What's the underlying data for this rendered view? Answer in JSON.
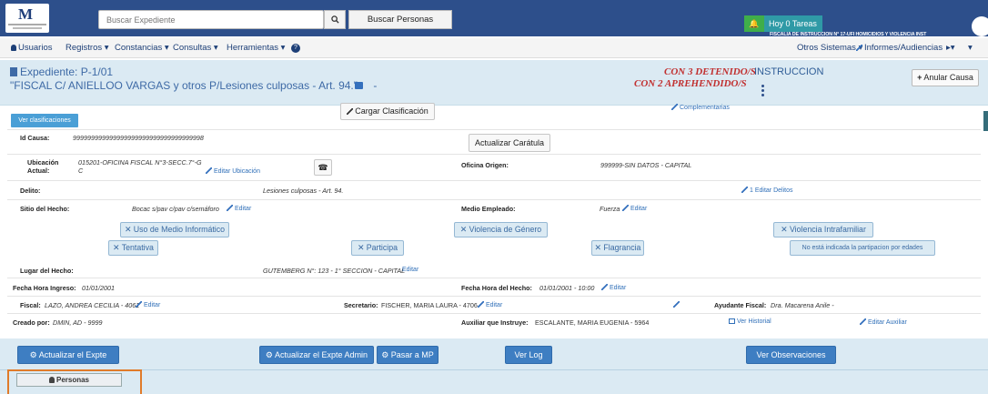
{
  "topbar": {
    "search_placeholder": "Buscar Expediente",
    "search_icon": "search-icon",
    "buscar_personas": "Buscar Personas",
    "tareas": "Hoy 0 Tareas",
    "fiscalia": "FISCALIA DE INSTRUCCION N° 17-UFI HOMICIDIOS Y VIOLENCIA INST",
    "colors": {
      "bar": "#2d4f8b",
      "bell": "#3fae4a",
      "tareas": "#2f9aa6"
    }
  },
  "menu": {
    "usuarios": "Usuarios",
    "registros": "Registros",
    "constancias": "Constancias",
    "consultas": "Consultas",
    "herramientas": "Herramientas",
    "otros_sistemas": "Otros Sistemas",
    "informes": "Informes/Audiencias"
  },
  "header": {
    "expediente": "Expediente: P-1/01",
    "caratula": "\"FISCAL C/ ANIELLOO VARGAS y otros P/Lesiones culposas - Art. 94.\"",
    "dash": "-",
    "detenidos": "CON 3 DETENIDO/S",
    "aprehendidos": "CON 2 APREHENDIDO/S",
    "estado": "INSTRUCCION",
    "anular": "Anular Causa",
    "anular_prefix": "+"
  },
  "actions": {
    "ver_clasificaciones": "Ver clasificaciones",
    "cargar_clasificacion": "Cargar Clasificación",
    "complementarias": "Complementarias"
  },
  "fields": {
    "id_causa_label": "Id Causa:",
    "id_causa": "999999999999999999999999999999999998",
    "actualizar_caratula": "Actualizar Carátula",
    "ubicacion_label": "Ubicación",
    "actual_label": "Actual:",
    "ubicacion_value": "015201-OFICINA FISCAL N°3-SECC.7°-G",
    "ubicacion_value2": "C",
    "editar_ubicacion": "Editar Ubicación",
    "oficina_origen_label": "Oficina Origen:",
    "oficina_origen": "999999-SIN DATOS - CAPITAL",
    "delito_label": "Delito:",
    "delito": "Lesiones culposas - Art. 94.",
    "editar_delitos": "1 Editar Delitos",
    "sitio_label": "Sitio del Hecho:",
    "sitio": "Bocac s/pav c/pav c/semáforo",
    "editar": "Editar",
    "medio_label": "Medio Empleado:",
    "medio": "Fuerza",
    "lugar_label": "Lugar del Hecho:",
    "lugar": "GUTEMBERG N°: 123 - 1° SECCION - CAPITAL",
    "fecha_ingreso_label": "Fecha Hora Ingreso:",
    "fecha_ingreso": "01/01/2001",
    "fecha_hecho_label": "Fecha Hora del Hecho:",
    "fecha_hecho": "01/01/2001 - 10:00",
    "fiscal_label": "Fiscal:",
    "fiscal": "LAZO, ANDREA CECILIA - 4061",
    "secretario_label": "Secretario:",
    "secretario": "FISCHER, MARIA LAURA - 4706",
    "ayudante_label": "Ayudante Fiscal:",
    "ayudante": "Dra. Macarena Anile -",
    "creado_label": "Creado por:",
    "creado": "DMIN, AD - 9999",
    "auxiliar_label": "Auxiliar que Instruye:",
    "auxiliar": "ESCALANTE, MARIA EUGENIA - 5964",
    "ver_historial": "Ver Historial",
    "editar_auxiliar": "Editar Auxiliar"
  },
  "tags": {
    "medio_informatico": "Uso de Medio Informático",
    "violencia_genero": "Violencia de Género",
    "violencia_intrafamiliar": "Violencia Intrafamiliar",
    "tentativa": "Tentativa",
    "participa": "Participa",
    "flagrancia": "Flagrancia",
    "participacion_edades": "No está indicada la partipacion por edades",
    "x_prefix": "✕"
  },
  "footer": {
    "actualizar": "Actualizar el Expte",
    "actualizar_admin": "Actualizar el Expte Admin",
    "pasar_mp": "Pasar a MP",
    "ver_log": "Ver Log",
    "ver_observaciones": "Ver Observaciones",
    "button_color": "#3e7ec2"
  },
  "tabs": {
    "personas": "Personas",
    "highlight_color": "#e07b2a"
  }
}
